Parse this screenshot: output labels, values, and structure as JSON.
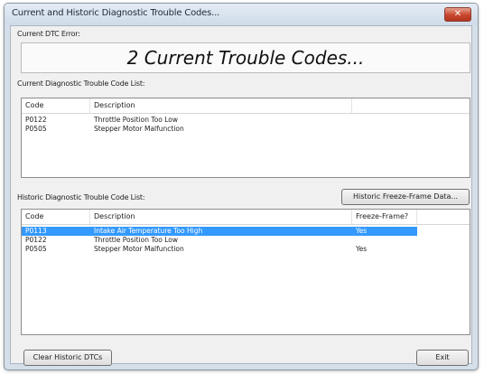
{
  "window": {
    "title": "Current and Historic Diagnostic Trouble Codes...",
    "close_glyph": "✕"
  },
  "current_error": {
    "label": "Current DTC Error:",
    "banner_text": "2 Current Trouble Codes..."
  },
  "current_list": {
    "label": "Current Diagnostic Trouble Code List:",
    "columns": [
      "Code",
      "Description"
    ],
    "rows": [
      {
        "code": "P0122",
        "description": "Throttle Position Too Low"
      },
      {
        "code": "P0505",
        "description": "Stepper Motor Malfunction"
      }
    ]
  },
  "historic_list": {
    "label": "Historic Diagnostic Trouble Code List:",
    "freeze_frame_button": "Historic Freeze-Frame Data...",
    "columns": [
      "Code",
      "Description",
      "Freeze-Frame?"
    ],
    "rows": [
      {
        "code": "P0113",
        "description": "Intake Air Temperature Too High",
        "freeze": "Yes",
        "selected": true
      },
      {
        "code": "P0122",
        "description": "Throttle Position Too Low",
        "freeze": "",
        "selected": false
      },
      {
        "code": "P0505",
        "description": "Stepper Motor Malfunction",
        "freeze": "Yes",
        "selected": false
      }
    ]
  },
  "footer": {
    "clear_button": "Clear Historic DTCs",
    "exit_button": "Exit"
  },
  "colors": {
    "selection": "#3399ff",
    "close_button": "#c8462c"
  }
}
